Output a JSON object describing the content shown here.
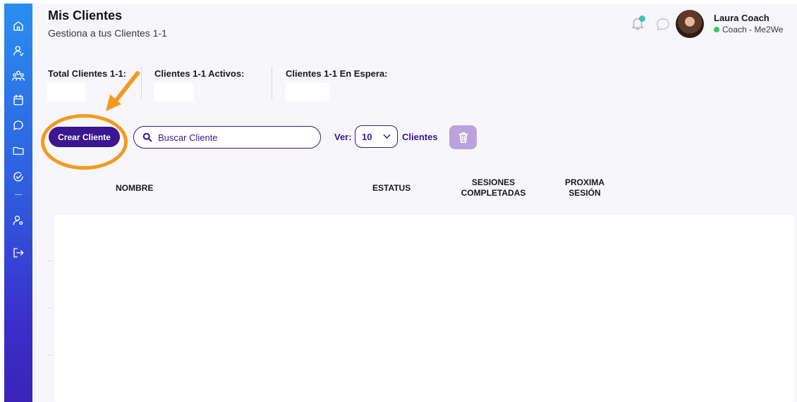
{
  "page": {
    "title": "Mis Clientes",
    "subtitle": "Gestiona a tus Clientes 1-1"
  },
  "user": {
    "name": "Laura Coach",
    "role": "Coach - Me2We",
    "status_color": "#2ecc5a"
  },
  "sidebar": {
    "items": [
      {
        "icon": "home-icon"
      },
      {
        "icon": "user-icon"
      },
      {
        "icon": "group-icon"
      },
      {
        "icon": "calendar-icon"
      },
      {
        "icon": "chat-icon"
      },
      {
        "icon": "folder-icon"
      },
      {
        "icon": "check-circle-icon"
      },
      {
        "icon": "user-settings-icon"
      },
      {
        "icon": "logout-icon"
      }
    ]
  },
  "stats": [
    {
      "label": "Total Clientes 1-1:",
      "value": ""
    },
    {
      "label": "Clientes 1-1 Activos:",
      "value": ""
    },
    {
      "label": "Clientes 1-1 En Espera:",
      "value": ""
    }
  ],
  "toolbar": {
    "create_label": "Crear Cliente",
    "search_placeholder": "Buscar Cliente",
    "ver_label": "Ver:",
    "per_page": "10",
    "clientes_label": "Clientes"
  },
  "table": {
    "headers": [
      "NOMBRE",
      "ESTATUS",
      "SESIONES COMPLETADAS",
      "PROXIMA SESIÓN"
    ],
    "rows": []
  },
  "colors": {
    "primary": "#3b1690",
    "highlight": "#f39a1e",
    "notification": "#3cc6b8",
    "trash_disabled": "#b9a3dd"
  }
}
